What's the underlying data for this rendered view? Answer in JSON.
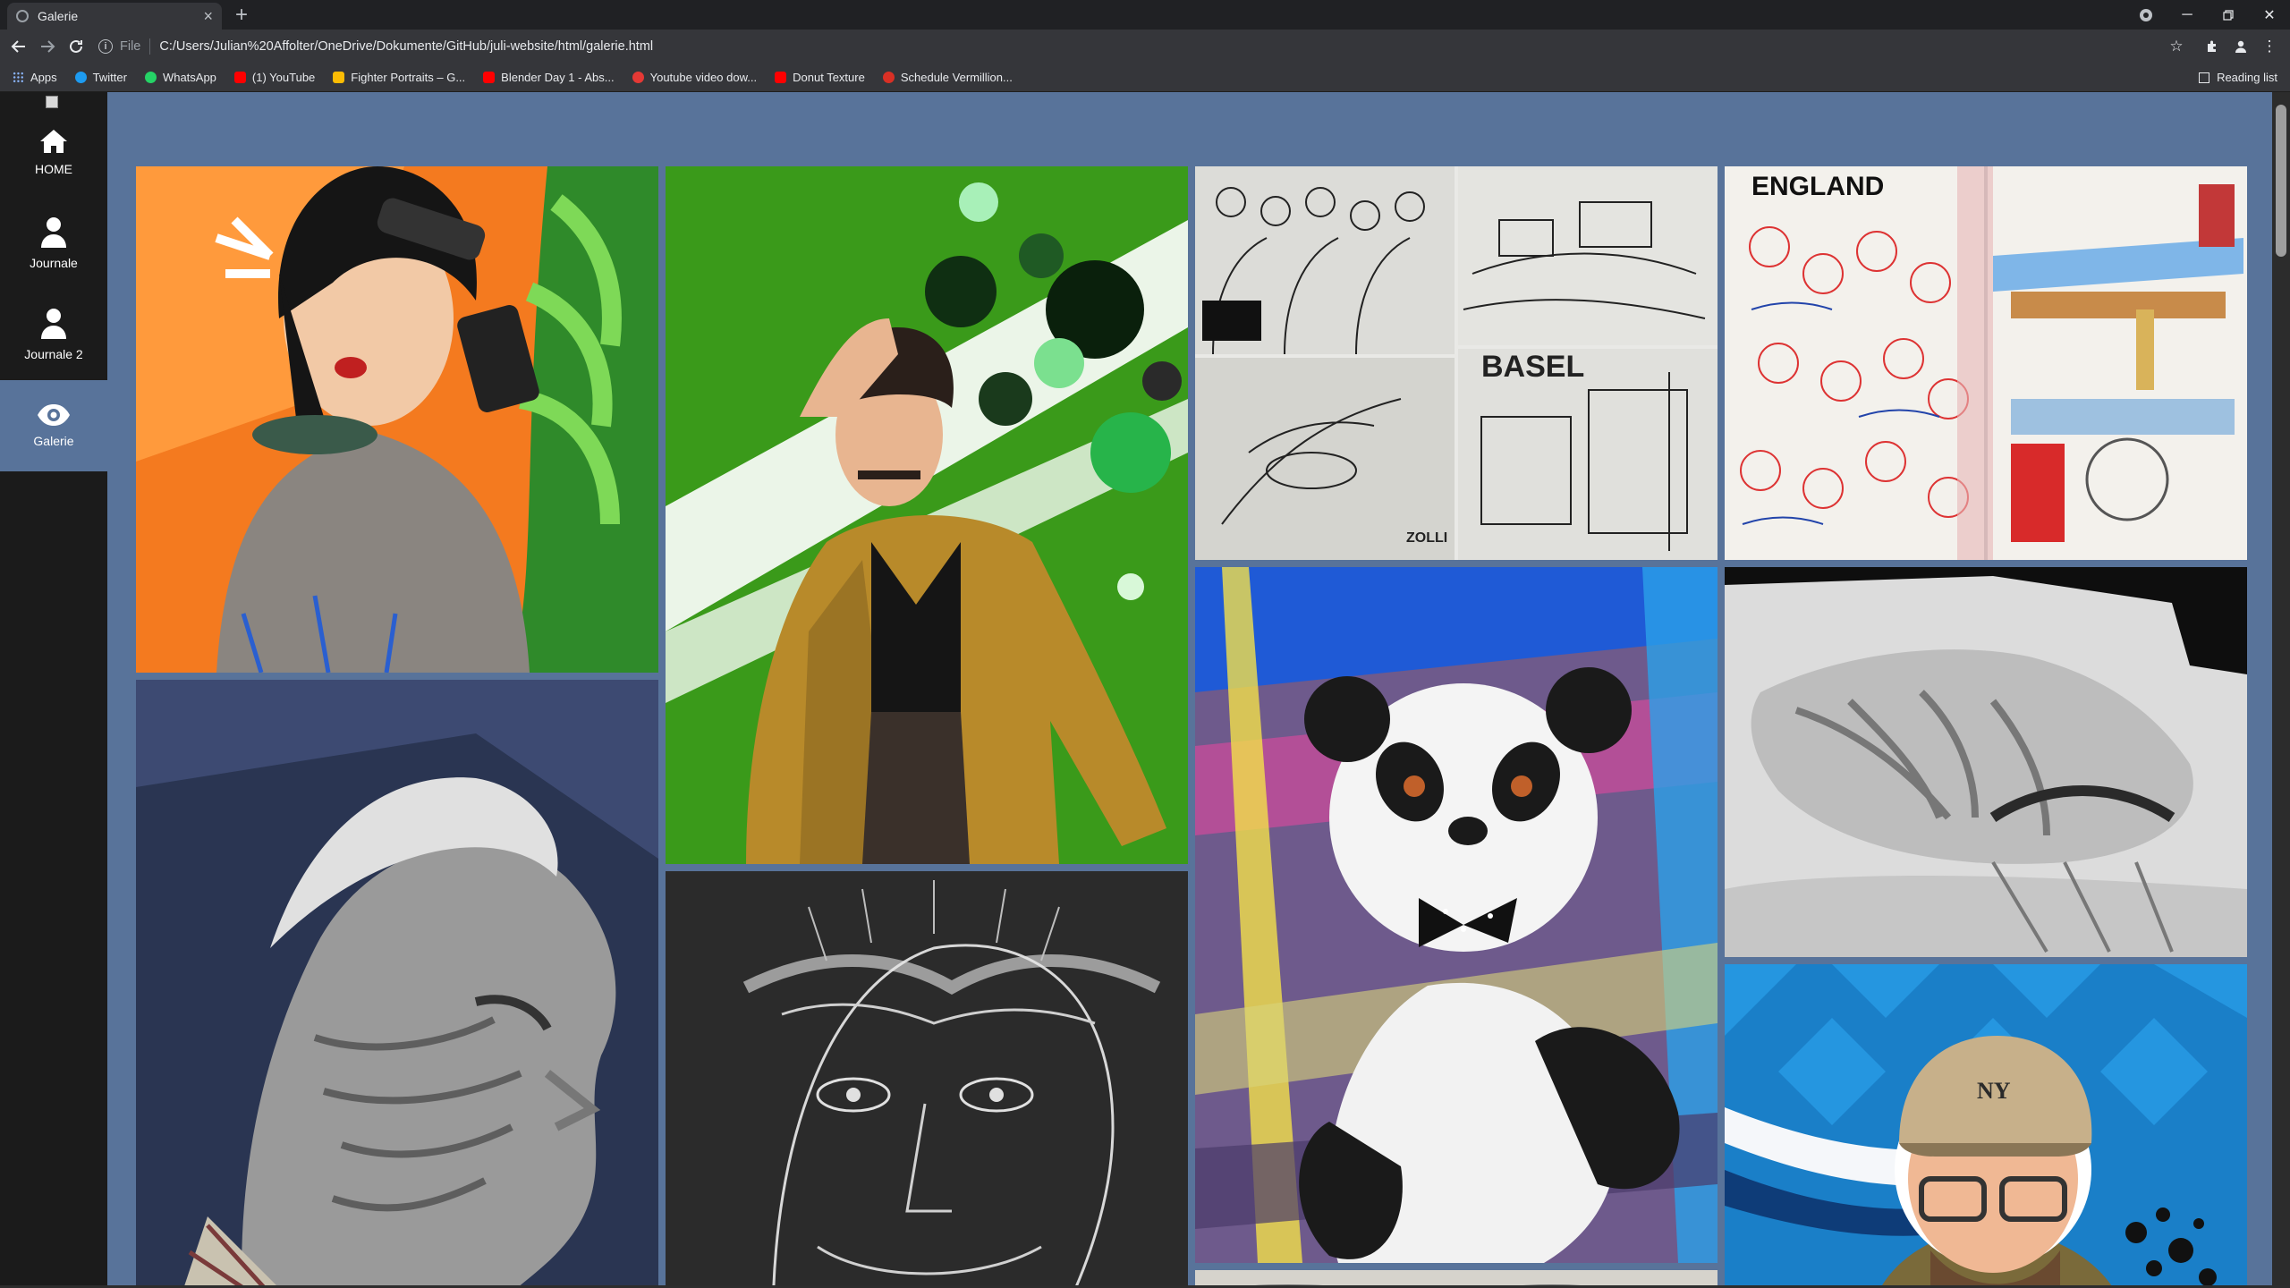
{
  "browser": {
    "tab": {
      "title": "Galerie"
    },
    "omnibox": {
      "scheme": "File",
      "url": "C:/Users/Julian%20Affolter/OneDrive/Dokumente/GitHub/juli-website/html/galerie.html"
    },
    "bookmarks": [
      {
        "label": "Apps",
        "icon": "apps-grid-icon",
        "color": "#8ab4f8"
      },
      {
        "label": "Twitter",
        "icon": "twitter-icon",
        "color": "#1d9bf0"
      },
      {
        "label": "WhatsApp",
        "icon": "whatsapp-icon",
        "color": "#25d366"
      },
      {
        "label": "(1) YouTube",
        "icon": "youtube-icon",
        "color": "#ff0000"
      },
      {
        "label": "Fighter Portraits – G...",
        "icon": "google-drive-icon",
        "color": "#fbbc04"
      },
      {
        "label": "Blender Day 1 - Abs...",
        "icon": "youtube-icon",
        "color": "#ff0000"
      },
      {
        "label": "Youtube video dow...",
        "icon": "download-site-icon",
        "color": "#e53935"
      },
      {
        "label": "Donut Texture",
        "icon": "youtube-icon",
        "color": "#ff0000"
      },
      {
        "label": "Schedule Vermillion...",
        "icon": "schedule-site-icon",
        "color": "#d93025"
      }
    ],
    "reading_list": "Reading list"
  },
  "sidebar": {
    "items": [
      {
        "label": "HOME",
        "icon": "home-icon",
        "active": false
      },
      {
        "label": "Journale",
        "icon": "person-icon",
        "active": false
      },
      {
        "label": "Journale 2",
        "icon": "person-icon",
        "active": false
      },
      {
        "label": "Galerie",
        "icon": "eye-icon",
        "active": true
      }
    ]
  },
  "gallery": {
    "images": [
      {
        "name": "woman-selfie-artwork",
        "subject": "woman with sunglasses taking phone selfie, orange background, green leaves"
      },
      {
        "name": "old-man-portrait-artwork",
        "subject": "grayscale digital portrait of old man on blue background"
      },
      {
        "name": "sequin-jacket-man-artwork",
        "subject": "man in gold sequin jacket on green background with circles"
      },
      {
        "name": "chalk-face-sketch-artwork",
        "subject": "white line drawing of face on black paper"
      },
      {
        "name": "basel-sketchbook-artwork",
        "subject": "pencil sketchbook spread",
        "text": "BASEL"
      },
      {
        "name": "panda-painting-artwork",
        "subject": "panda plush painted on colorful abstract background"
      },
      {
        "name": "england-sketchbook-artwork",
        "subject": "watercolor sketchbook of England scenes",
        "text": "ENGLAND"
      },
      {
        "name": "charcoal-pillow-artwork",
        "subject": "charcoal drawing of a pillow"
      },
      {
        "name": "man-cap-glasses-artwork",
        "subject": "cartoon man with NY cap and glasses on blue background"
      }
    ]
  }
}
